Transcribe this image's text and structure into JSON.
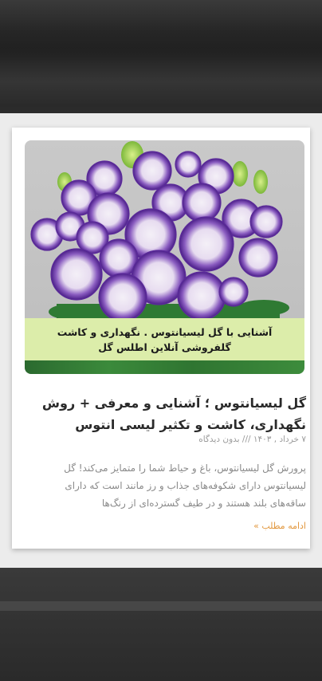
{
  "post": {
    "image_caption_line1": "آشنایی با گل لیسیانتوس . نگهداری و کاشت",
    "image_caption_line2": "گلفروشی آنلاین اطلس گل",
    "title": "گل لیسیانتوس ؛ آشنایی و معرفی + روش نگهداری، کاشت و تکثیر لیسی انتوس",
    "meta": "۷ خرداد , ۱۴۰۳ /// بدون دیدگاه",
    "excerpt": "پرورش گل لیسیانتوس، باغ و حیاط شما را متمایز می‌کند! گل لیسیانتوس دارای شکوفه‌های جذاب و رز مانند است که دارای ساقه‌های بلند هستند و در طیف گسترده‌ای از رنگ‌ها",
    "read_more": "ادامه مطلب »"
  },
  "colors": {
    "caption_bg": "#dcedaa",
    "read_more": "#e2973d",
    "flower_purple": "#5b2a9a"
  }
}
